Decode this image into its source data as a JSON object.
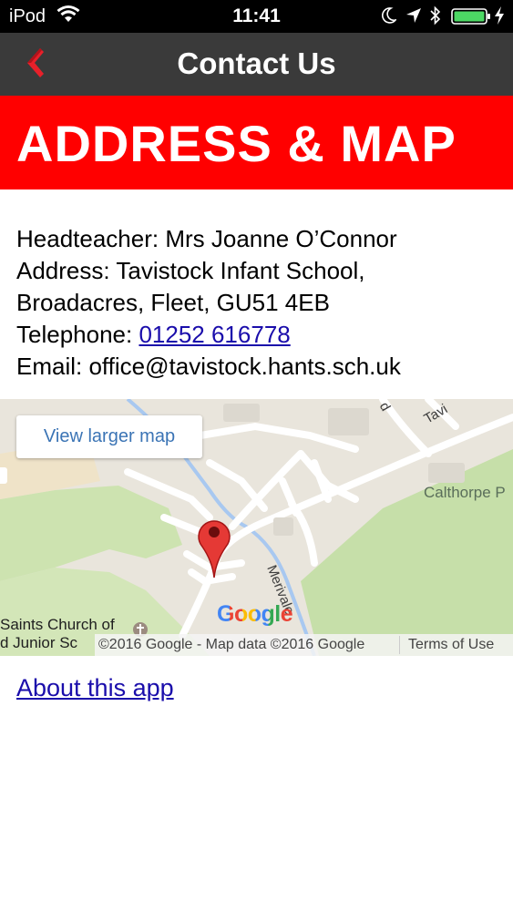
{
  "status_bar": {
    "carrier": "iPod",
    "time": "11:41"
  },
  "nav": {
    "title": "Contact Us",
    "back_icon": "back-chevron-icon"
  },
  "banner": {
    "heading": "ADDRESS & MAP"
  },
  "contact": {
    "headteacher": "Headteacher: Mrs Joanne O’Connor",
    "address_line1": "Address: Tavistock Infant School,",
    "address_line2": "Broadacres, Fleet, GU51 4EB",
    "telephone_label": "Telephone: ",
    "telephone_number": "01252 616778",
    "email": "Email: office@tavistock.hants.sch.uk"
  },
  "map": {
    "larger_map_label": "View larger map",
    "labels": {
      "calthorpe": "Calthorpe P",
      "saints": "Saints Church of",
      "junior": "d Junior Sc",
      "merivale": "Merivale",
      "tavi": "Tavi",
      "d": "d"
    },
    "logo": "Google",
    "copyright": "©2016 Google - Map data ©2016 Google",
    "terms": "Terms of Use"
  },
  "footer": {
    "about_link": "About this app"
  },
  "colors": {
    "banner": "#ff0000",
    "navbar": "#3a3a3a",
    "link": "#1a0dab",
    "accent_back": "#e8202a"
  }
}
